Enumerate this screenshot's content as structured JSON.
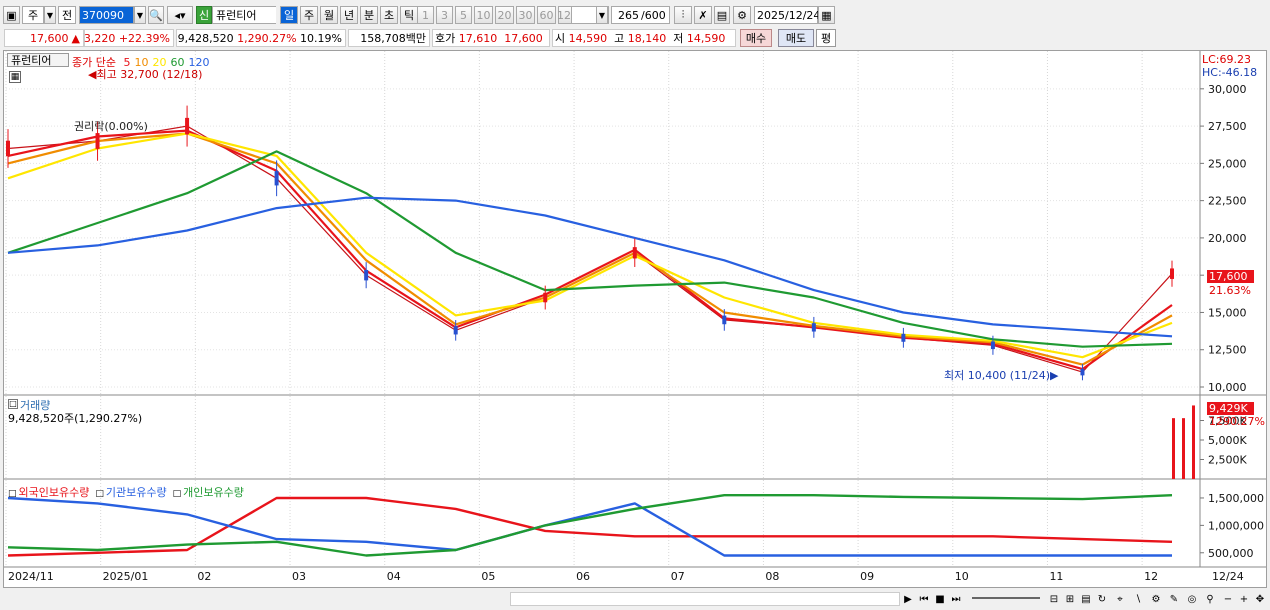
{
  "toolbar": {
    "period_type": "주",
    "prev_label": "전",
    "stock_code": "370090",
    "new_badge": "신",
    "stock_name": "퓨런티어",
    "period_tabs": [
      "일",
      "주",
      "월",
      "년",
      "분",
      "초",
      "틱"
    ],
    "active_period": "일",
    "interval_options": [
      "1",
      "3",
      "5",
      "10",
      "20",
      "30",
      "60",
      "120"
    ],
    "count_display": "265",
    "count_max": "/600",
    "date": "2025/12/24"
  },
  "quote": {
    "price": "17,600",
    "change": "3,220",
    "change_pct": "+22.39%",
    "volume": "9,428,520",
    "volume_pct": "1,290.27%",
    "turnover_pct": "10.19%",
    "amount": "158,708백만",
    "bid_label": "호가",
    "bid1": "17,610",
    "bid2": "17,600",
    "open_label": "시",
    "open": "14,590",
    "high_label": "고",
    "high": "18,140",
    "low_label": "저",
    "low": "14,590",
    "buy_label": "매수",
    "sell_label": "매도",
    "avg_label": "평"
  },
  "price_panel": {
    "stock_label": "퓨런티어",
    "ma_label": "종가 단순",
    "ma_periods": [
      "5",
      "10",
      "20",
      "60",
      "120"
    ],
    "ma_colors": [
      "#e8141b",
      "#f08c00",
      "#ffe600",
      "#1f9a32",
      "#2860e0"
    ],
    "high_marker": "최고 32,700 (12/18)",
    "low_marker": "최저 10,400 (11/24)",
    "rights_note": "권리락(0.00%)",
    "lc_label": "LC:69.23",
    "hc_label": "HC:-46.18",
    "last_price_tag": "17,600",
    "last_pct_tag": "21.63%",
    "y_ticks": [
      "30,000",
      "27,500",
      "25,000",
      "22,500",
      "20,000",
      "17,500",
      "15,000",
      "12,500",
      "10,000"
    ]
  },
  "volume_panel": {
    "label": "거래량",
    "value_text": "9,428,520주(1,290.27%)",
    "last_tag": "9,429K",
    "last_pct_tag": "1290.27%",
    "y_ticks": [
      "7,500K",
      "5,000K",
      "2,500K"
    ]
  },
  "holding_panel": {
    "series_labels": [
      "외국인보유수량",
      "기관보유수량",
      "개인보유수량"
    ],
    "series_colors": [
      "#e8141b",
      "#2860e0",
      "#1f9a32"
    ],
    "y_ticks": [
      "1,500,000",
      "1,000,000",
      "500,000"
    ]
  },
  "x_axis": {
    "labels": [
      "2024/11",
      "2025/01",
      "02",
      "03",
      "04",
      "05",
      "06",
      "07",
      "08",
      "09",
      "10",
      "11",
      "12"
    ],
    "right_label": "12/24"
  },
  "chart_data": {
    "type": "line",
    "x": [
      "2024/11",
      "2024/12",
      "2025/01",
      "2025/02",
      "2025/03",
      "2025/04",
      "2025/05",
      "2025/06",
      "2025/07",
      "2025/08",
      "2025/09",
      "2025/10",
      "2025/11",
      "2025/12"
    ],
    "series": [
      {
        "name": "종가",
        "values": [
          26000,
          26500,
          27500,
          24000,
          17500,
          13800,
          16000,
          19000,
          14500,
          14000,
          13300,
          12800,
          11000,
          17600
        ]
      },
      {
        "name": "5",
        "values": [
          25500,
          26800,
          27200,
          24500,
          17800,
          14000,
          16200,
          19200,
          14600,
          14000,
          13300,
          12900,
          11200,
          15500
        ]
      },
      {
        "name": "10",
        "values": [
          25000,
          26500,
          27000,
          25000,
          18500,
          14200,
          16000,
          19000,
          15000,
          14100,
          13400,
          13000,
          11500,
          14800
        ]
      },
      {
        "name": "20",
        "values": [
          24000,
          26000,
          27000,
          25500,
          19000,
          14800,
          15800,
          18800,
          16000,
          14300,
          13500,
          13100,
          12000,
          14300
        ]
      },
      {
        "name": "60",
        "values": [
          19000,
          21000,
          23000,
          25800,
          23000,
          19000,
          16500,
          16800,
          17000,
          16000,
          14300,
          13200,
          12700,
          12900
        ]
      },
      {
        "name": "120",
        "values": [
          19000,
          19500,
          20500,
          22000,
          22700,
          22500,
          21500,
          20000,
          18500,
          16500,
          15000,
          14200,
          13800,
          13400
        ]
      }
    ],
    "ylim": [
      10000,
      32000
    ],
    "volume": {
      "unit": "K",
      "last": 9429,
      "recent_spikes": [
        7800,
        7800,
        9429
      ]
    },
    "holdings": {
      "외국인보유수량": [
        450000,
        500000,
        550000,
        1500000,
        1500000,
        1300000,
        900000,
        800000,
        800000,
        800000,
        800000,
        800000,
        750000,
        700000
      ],
      "기관보유수량": [
        1500000,
        1400000,
        1200000,
        750000,
        700000,
        550000,
        1000000,
        1400000,
        450000,
        450000,
        450000,
        450000,
        450000,
        450000
      ],
      "개인보유수량": [
        600000,
        550000,
        650000,
        700000,
        450000,
        550000,
        1000000,
        1300000,
        1550000,
        1550000,
        1520000,
        1500000,
        1480000,
        1550000
      ]
    }
  }
}
